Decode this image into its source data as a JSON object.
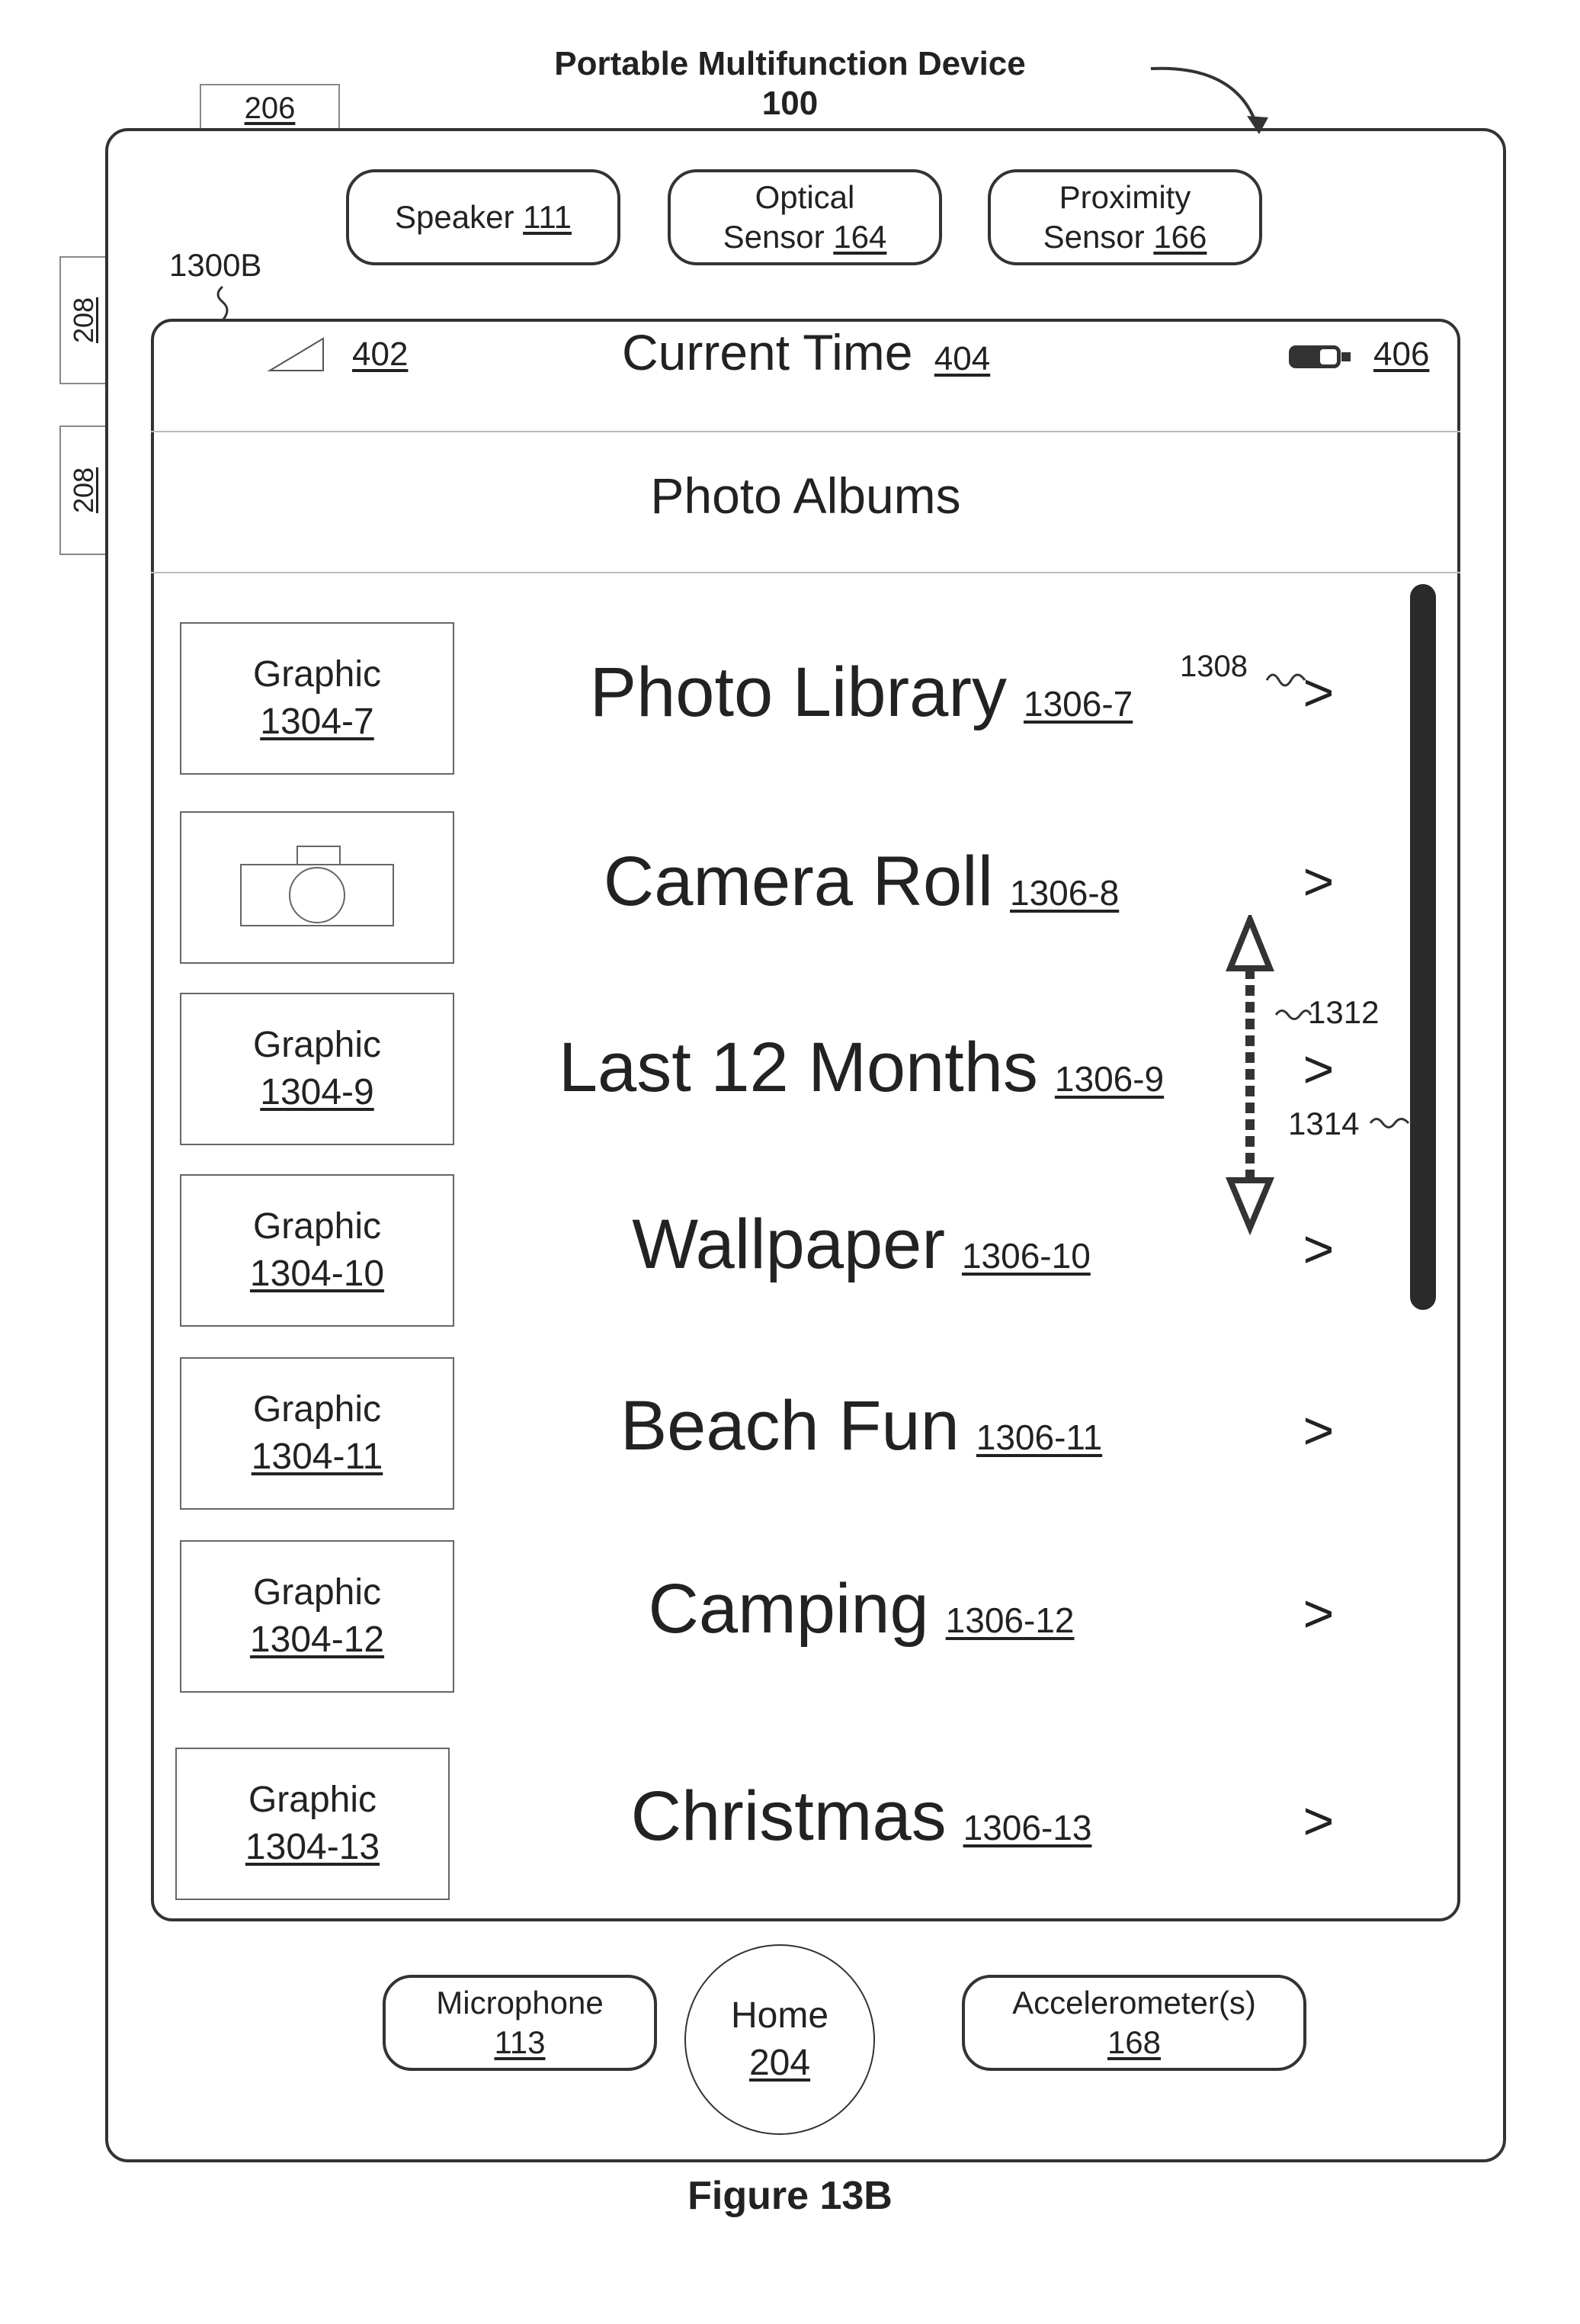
{
  "header": {
    "line1": "Portable Multifunction Device",
    "line2": "100"
  },
  "device": {
    "tab_ref": "206",
    "side_buttons": [
      "208",
      "208"
    ],
    "top_components": [
      {
        "label": "Speaker",
        "ref": "111"
      },
      {
        "label": "Optical",
        "label2": "Sensor",
        "ref": "164"
      },
      {
        "label": "Proximity",
        "label2": "Sensor",
        "ref": "166"
      }
    ],
    "screen_ref": "1300B",
    "bottom_components": [
      {
        "label": "Microphone",
        "ref": "113"
      },
      {
        "label": "Home",
        "ref": "204"
      },
      {
        "label": "Accelerometer(s)",
        "ref": "168"
      }
    ]
  },
  "status_bar": {
    "signal_ref": "402",
    "time_label": "Current Time",
    "time_ref": "404",
    "battery_ref": "406"
  },
  "nav": {
    "title": "Photo Albums"
  },
  "albums": [
    {
      "graphic": "Graphic",
      "graphic_ref": "1304-7",
      "title": "Photo Library",
      "ref": "1306-7",
      "chevron": ">"
    },
    {
      "graphic": "camera-icon",
      "title": "Camera Roll",
      "ref": "1306-8",
      "chevron": ">"
    },
    {
      "graphic": "Graphic",
      "graphic_ref": "1304-9",
      "title": "Last 12 Months",
      "ref": "1306-9",
      "chevron": ">"
    },
    {
      "graphic": "Graphic",
      "graphic_ref": "1304-10",
      "title": "Wallpaper",
      "ref": "1306-10",
      "chevron": ">"
    },
    {
      "graphic": "Graphic",
      "graphic_ref": "1304-11",
      "title": "Beach Fun",
      "ref": "1306-11",
      "chevron": ">"
    },
    {
      "graphic": "Graphic",
      "graphic_ref": "1304-12",
      "title": "Camping",
      "ref": "1306-12",
      "chevron": ">"
    },
    {
      "graphic": "Graphic",
      "graphic_ref": "1304-13",
      "title": "Christmas",
      "ref": "1306-13",
      "chevron": ">"
    }
  ],
  "annotations": {
    "chevron_ref": "1308",
    "gesture_ref": "1312",
    "scrollbar_ref": "1314"
  },
  "caption": "Figure 13B"
}
